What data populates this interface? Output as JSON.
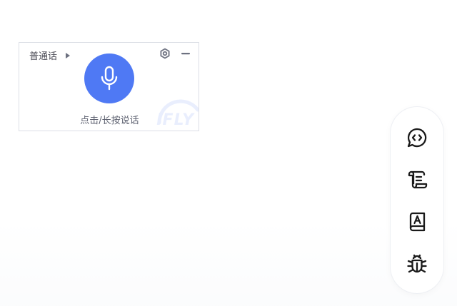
{
  "voice_widget": {
    "language_label": "普通话",
    "hint_text": "点击/长按说话",
    "watermark": "iFLY",
    "icons": {
      "language_arrow": "caret-right-icon",
      "settings": "settings-icon",
      "minimize": "minimize-icon",
      "microphone": "microphone-icon"
    },
    "accent_color": "#4f79f4"
  },
  "tool_rail": {
    "items": [
      {
        "name": "chat-code-icon"
      },
      {
        "name": "scroll-icon"
      },
      {
        "name": "dictionary-book-icon"
      },
      {
        "name": "bug-icon"
      }
    ]
  }
}
